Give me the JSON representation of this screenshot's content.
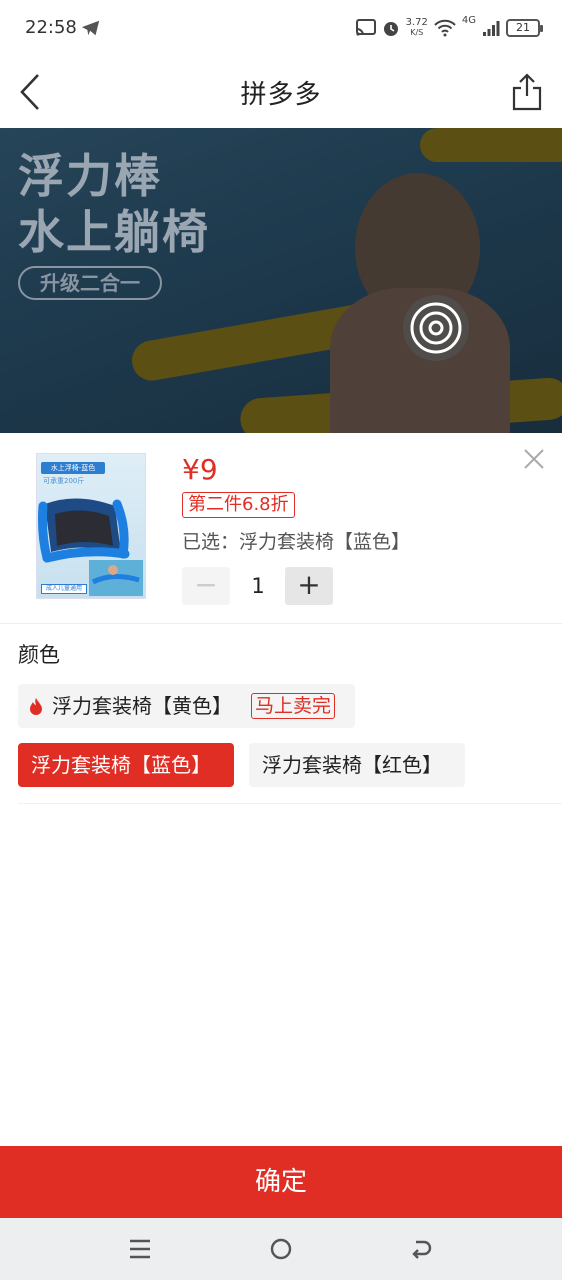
{
  "status_bar": {
    "time": "22:58",
    "network_speed_value": "3.72",
    "network_speed_unit": "K/S",
    "network_type": "4G",
    "battery": "21",
    "icons": [
      "telegram-icon",
      "cast-icon",
      "alarm-icon",
      "wifi-icon",
      "signal-icon",
      "battery-icon"
    ]
  },
  "nav": {
    "title": "拼多多"
  },
  "banner": {
    "title_line1": "浮力棒",
    "title_line2": "水上躺椅",
    "tag": "升级二合一"
  },
  "product": {
    "image_tag": "水上浮椅-蓝色",
    "image_sub": "可承重200斤",
    "image_bottom": "成人儿童通用",
    "price": "¥9",
    "discount": "第二件6.8折",
    "selected_text": "已选：浮力套装椅【蓝色】",
    "quantity": "1",
    "minus_label": "−",
    "plus_label": "+"
  },
  "color_section": {
    "label": "颜色",
    "options": [
      {
        "label": "浮力套装椅【黄色】",
        "tag": "马上卖完",
        "selected": false
      },
      {
        "label": "浮力套装椅【蓝色】",
        "selected": true
      },
      {
        "label": "浮力套装椅【红色】",
        "selected": false
      }
    ]
  },
  "confirm_label": "确定",
  "colors": {
    "accent": "#e02e24",
    "option_bg": "#f4f4f4"
  }
}
